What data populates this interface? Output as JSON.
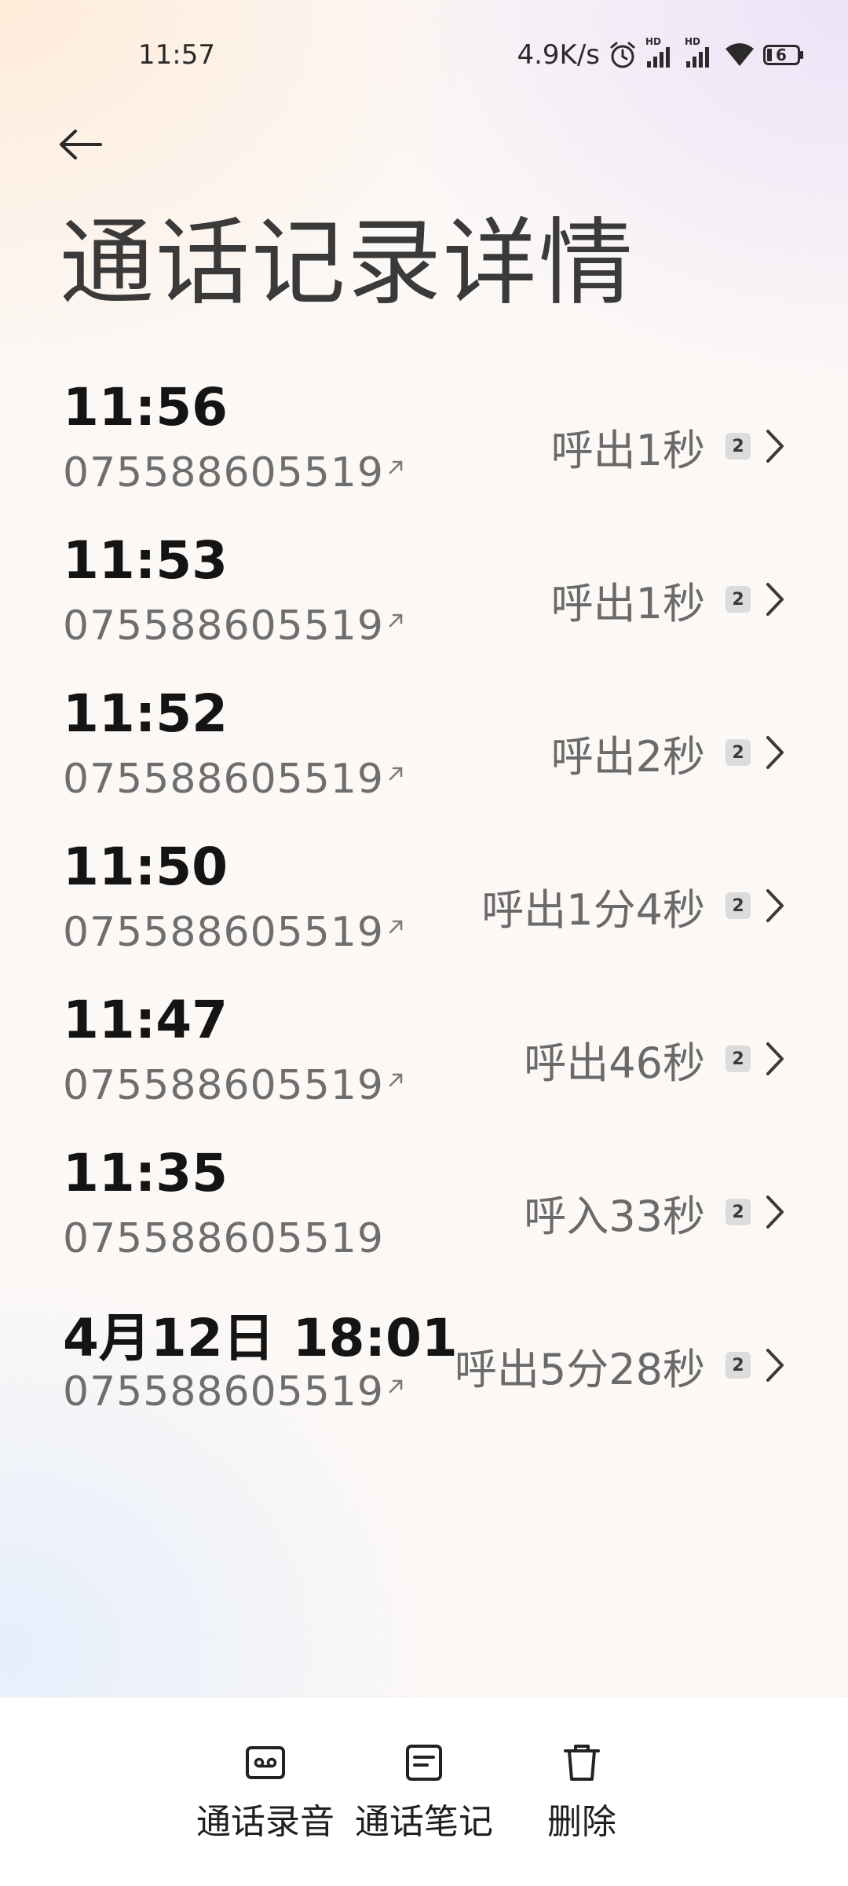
{
  "status_bar": {
    "time": "11:57",
    "net_speed": "4.9K/s",
    "hd1": "HD",
    "hd2": "HD",
    "battery": "6",
    "icons": [
      "alarm-icon",
      "signal-hd-icon",
      "signal-hd-icon",
      "wifi-icon",
      "battery-icon"
    ]
  },
  "header": {
    "title": "通话记录详情"
  },
  "calls": [
    {
      "time": "11:56",
      "number": "075588605519",
      "status": "呼出1秒",
      "sim": "2",
      "outgoing": true
    },
    {
      "time": "11:53",
      "number": "075588605519",
      "status": "呼出1秒",
      "sim": "2",
      "outgoing": true
    },
    {
      "time": "11:52",
      "number": "075588605519",
      "status": "呼出2秒",
      "sim": "2",
      "outgoing": true
    },
    {
      "time": "11:50",
      "number": "075588605519",
      "status": "呼出1分4秒",
      "sim": "2",
      "outgoing": true
    },
    {
      "time": "11:47",
      "number": "075588605519",
      "status": "呼出46秒",
      "sim": "2",
      "outgoing": true
    },
    {
      "time": "11:35",
      "number": "075588605519",
      "status": "呼入33秒",
      "sim": "2",
      "outgoing": false
    },
    {
      "time": "4月12日 18:01",
      "number": "075588605519",
      "status": "呼出5分28秒",
      "sim": "2",
      "outgoing": true
    }
  ],
  "bottom_bar": {
    "recording_label": "通话录音",
    "notes_label": "通话笔记",
    "delete_label": "删除"
  }
}
